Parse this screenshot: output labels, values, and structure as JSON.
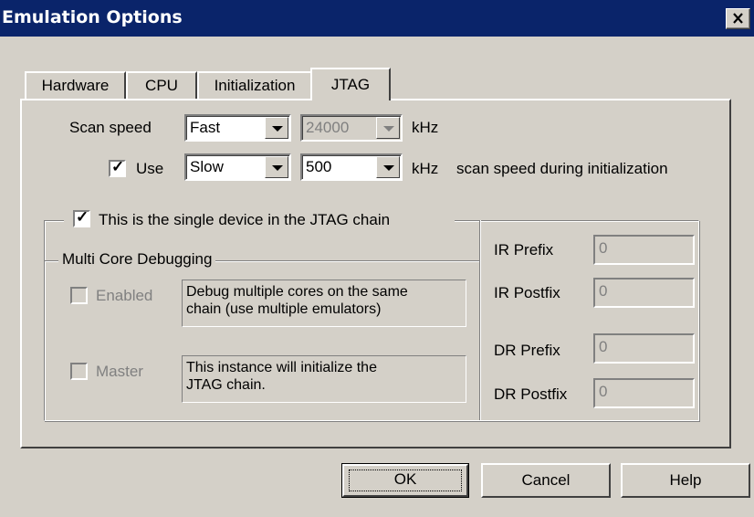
{
  "window": {
    "title": "Emulation Options"
  },
  "tabs": [
    {
      "label": "Hardware"
    },
    {
      "label": "CPU"
    },
    {
      "label": "Initialization"
    },
    {
      "label": "JTAG"
    }
  ],
  "scan": {
    "label": "Scan speed",
    "speed_value": "Fast",
    "freq_value": "24000",
    "unit": "kHz"
  },
  "use": {
    "label": "Use",
    "checked": true,
    "speed_value": "Slow",
    "freq_value": "500",
    "unit": "kHz",
    "suffix": "scan speed during initialization"
  },
  "single_device": {
    "label": "This is the single device in the JTAG chain",
    "checked": true
  },
  "multi_core": {
    "label": "Multi Core Debugging",
    "enabled_label": "Enabled",
    "enabled_desc_line1": "Debug multiple cores on the same",
    "enabled_desc_line2": "chain (use multiple emulators)",
    "master_label": "Master",
    "master_desc_line1": "This instance will initialize the",
    "master_desc_line2": "JTAG chain."
  },
  "prefix": {
    "ir_prefix_label": "IR Prefix",
    "ir_prefix_value": "0",
    "ir_postfix_label": "IR Postfix",
    "ir_postfix_value": "0",
    "dr_prefix_label": "DR Prefix",
    "dr_prefix_value": "0",
    "dr_postfix_label": "DR Postfix",
    "dr_postfix_value": "0"
  },
  "buttons": {
    "ok": "OK",
    "cancel": "Cancel",
    "help": "Help"
  }
}
